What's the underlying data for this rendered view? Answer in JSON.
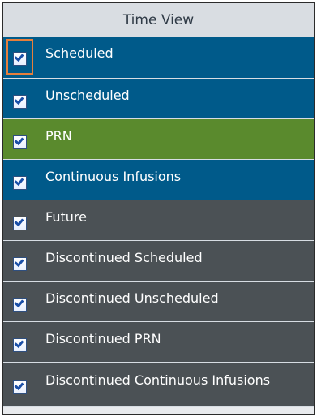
{
  "header": {
    "title": "Time View"
  },
  "colors": {
    "scheduled": "#005a8a",
    "unscheduled": "#005a8a",
    "prn": "#5a8a2d",
    "continuous": "#005a8a",
    "gray": "#4b5155",
    "focus": "#e67f3c"
  },
  "items": [
    {
      "label": "Scheduled",
      "checked": true
    },
    {
      "label": "Unscheduled",
      "checked": true
    },
    {
      "label": "PRN",
      "checked": true
    },
    {
      "label": "Continuous Infusions",
      "checked": true
    },
    {
      "label": "Future",
      "checked": true
    },
    {
      "label": "Discontinued Scheduled",
      "checked": true
    },
    {
      "label": "Discontinued Unscheduled",
      "checked": true
    },
    {
      "label": "Discontinued PRN",
      "checked": true
    },
    {
      "label": "Discontinued Continuous Infusions",
      "checked": true
    }
  ]
}
